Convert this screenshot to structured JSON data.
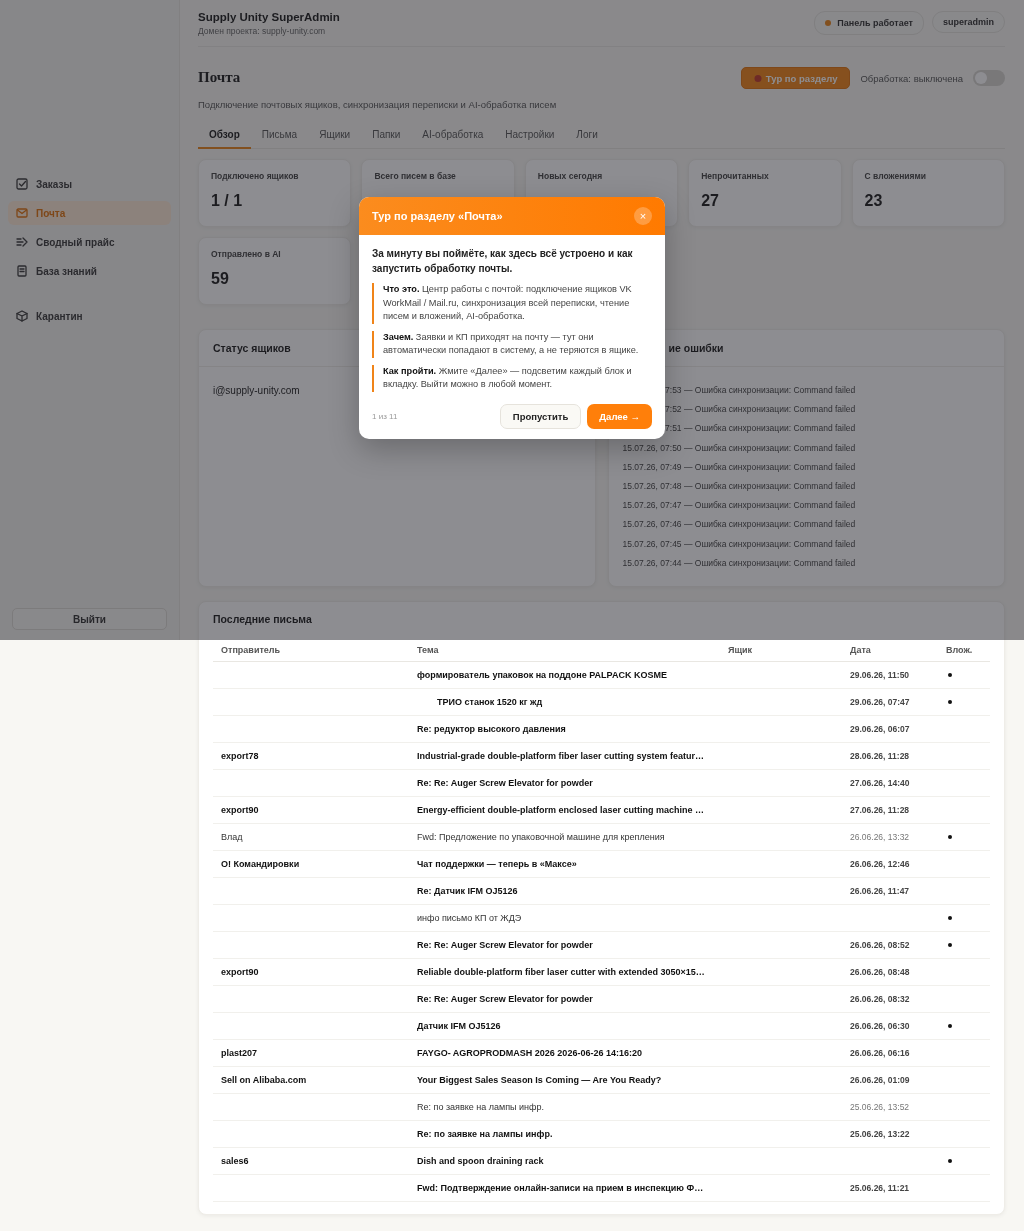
{
  "app": {
    "title": "Supply Unity SuperAdmin",
    "domain": "Домен проекта: supply-unity.com",
    "status": "Панель работает",
    "user": "superadmin"
  },
  "sidebar": {
    "items": [
      {
        "kind": "orders",
        "label": "Заказы",
        "selected": false
      },
      {
        "kind": "mail",
        "label": "Почта",
        "selected": true
      },
      {
        "kind": "price",
        "label": "Сводный прайс",
        "selected": false
      },
      {
        "kind": "knowledge",
        "label": "База знаний",
        "selected": false
      },
      {
        "kind": "quarantine",
        "label": "Карантин",
        "selected": false
      }
    ],
    "logout": "Выйти"
  },
  "page": {
    "title": "Почта",
    "subtitle": "Подключение почтовых ящиков, синхронизация переписки и AI-обработка писем",
    "tour_button": "Тур по разделу",
    "processing": {
      "label": "Обработка: выключена",
      "on": false
    }
  },
  "tabs": [
    {
      "label": "Обзор",
      "selected": true
    },
    {
      "label": "Письма",
      "selected": false
    },
    {
      "label": "Ящики",
      "selected": false
    },
    {
      "label": "Папки",
      "selected": false
    },
    {
      "label": "AI-обработка",
      "selected": false
    },
    {
      "label": "Настройки",
      "selected": false
    },
    {
      "label": "Логи",
      "selected": false
    }
  ],
  "stats": [
    {
      "label": "Подключено ящиков",
      "value": "1 / 1"
    },
    {
      "label": "Всего писем в базе"
    },
    {
      "label": "Новых сегодня"
    },
    {
      "label": "Непрочитанных",
      "value": "27"
    },
    {
      "label": "С вложениями",
      "value": "23"
    },
    {
      "label": "Отправлено в AI",
      "value": "59"
    }
  ],
  "mailbox_status": {
    "title": "Статус ящиков",
    "mailboxes": [
      "i@supply-unity.com"
    ]
  },
  "recent_errors": {
    "title": "ие ошибки",
    "items": [
      "7:53 — Ошибка синхронизации: Command failed",
      "7:52 — Ошибка синхронизации: Command failed",
      "7:51 — Ошибка синхронизации: Command failed",
      "15.07.26, 07:50 — Ошибка синхронизации: Command failed",
      "15.07.26, 07:49 — Ошибка синхронизации: Command failed",
      "15.07.26, 07:48 — Ошибка синхронизации: Command failed",
      "15.07.26, 07:47 — Ошибка синхронизации: Command failed",
      "15.07.26, 07:46 — Ошибка синхронизации: Command failed",
      "15.07.26, 07:45 — Ошибка синхронизации: Command failed",
      "15.07.26, 07:44 — Ошибка синхронизации: Command failed"
    ]
  },
  "recent_mail": {
    "title": "Последние письма",
    "columns": [
      "Отправитель",
      "Тема",
      "Ящик",
      "Дата",
      "Влож."
    ],
    "rows": [
      {
        "subject": "формирователь упаковок на поддоне PALPACK KOSME",
        "date": "29.06.26, 11:50",
        "unread": true,
        "attachment": true
      },
      {
        "subject": "        ТРИО станок 1520 кг жд",
        "date": "29.06.26, 07:47",
        "unread": true,
        "attachment": true
      },
      {
        "subject": "Re: редуктор высокого давления",
        "date": "29.06.26, 06:07",
        "unread": true,
        "attachment": false
      },
      {
        "sender": "export78",
        "subject": "Industrial-grade double-platform fiber laser cutting system featur…",
        "date": "28.06.26, 11:28",
        "unread": true,
        "attachment": false
      },
      {
        "subject": "Re: Re: Auger Screw Elevator for powder",
        "date": "27.06.26, 14:40",
        "unread": true,
        "attachment": false
      },
      {
        "sender": "export90",
        "subject": "Energy-efficient double-platform enclosed laser cutting machine …",
        "date": "27.06.26, 11:28",
        "unread": true,
        "attachment": false
      },
      {
        "sender": "Влад",
        "subject": "Fwd: Предложение по упаковочной машине для крепления",
        "date": "26.06.26, 13:32",
        "unread": false,
        "attachment": true
      },
      {
        "sender": "О! Командировки",
        "subject": "Чат поддержки — теперь в «Максе»",
        "date": "26.06.26, 12:46",
        "unread": true,
        "attachment": false
      },
      {
        "subject": "Re: Датчик IFM OJ5126",
        "date": "26.06.26, 11:47",
        "unread": true,
        "attachment": false
      },
      {
        "subject": "инфо письмо КП от ЖДЭ",
        "unread": false,
        "attachment": true
      },
      {
        "subject": "Re: Re: Auger Screw Elevator for powder",
        "date": "26.06.26, 08:52",
        "unread": true,
        "attachment": true
      },
      {
        "sender": "export90",
        "subject": "Reliable double-platform fiber laser cutter with extended 3050×15…",
        "date": "26.06.26, 08:48",
        "unread": true,
        "attachment": false
      },
      {
        "subject": "Re: Re: Auger Screw Elevator for powder",
        "date": "26.06.26, 08:32",
        "unread": true,
        "attachment": false
      },
      {
        "subject": "Датчик IFM OJ5126",
        "date": "26.06.26, 06:30",
        "unread": true,
        "attachment": true
      },
      {
        "sender": "plast207",
        "subject": "FAYGO- AGROPRODMASH 2026 2026-06-26 14:16:20",
        "date": "26.06.26, 06:16",
        "unread": true,
        "attachment": false
      },
      {
        "sender": "Sell on Alibaba.com",
        "subject": "Your Biggest Sales Season Is Coming — Are You Ready?",
        "date": "26.06.26, 01:09",
        "unread": true,
        "attachment": false
      },
      {
        "subject": "Re: по заявке на лампы инфр.",
        "date": "25.06.26, 13:52",
        "unread": false,
        "attachment": false
      },
      {
        "subject": "Re: по заявке на лампы инфр.",
        "date": "25.06.26, 13:22",
        "unread": true,
        "attachment": false
      },
      {
        "sender": "sales6",
        "subject": "Dish and spoon draining rack",
        "unread": true,
        "attachment": true
      },
      {
        "subject": "Fwd: Подтверждение онлайн-записи на прием в инспекцию Ф…",
        "date": "25.06.26, 11:21",
        "unread": true,
        "attachment": false
      }
    ]
  },
  "tour": {
    "title": "Тур по разделу «Почта»",
    "close": "×",
    "intro": "За минуту вы поймёте, как здесь всё устроено и как запустить обработку почты.",
    "points": [
      "**Что это.** Центр работы с почтой: подключение ящиков VK WorkMail / Mail.ru, синхронизация всей переписки, чтение писем и вложений, AI-обработка.",
      "**Зачем.** Заявки и КП приходят на почту — тут они автоматически попадают в систему, а не теряются в ящике.",
      "**Как пройти.** Жмите «Далее» — подсветим каждый блок и вкладку. Выйти можно в любой момент."
    ],
    "step": "1 из 11",
    "skip": "Пропустить",
    "next": "Далее →"
  }
}
